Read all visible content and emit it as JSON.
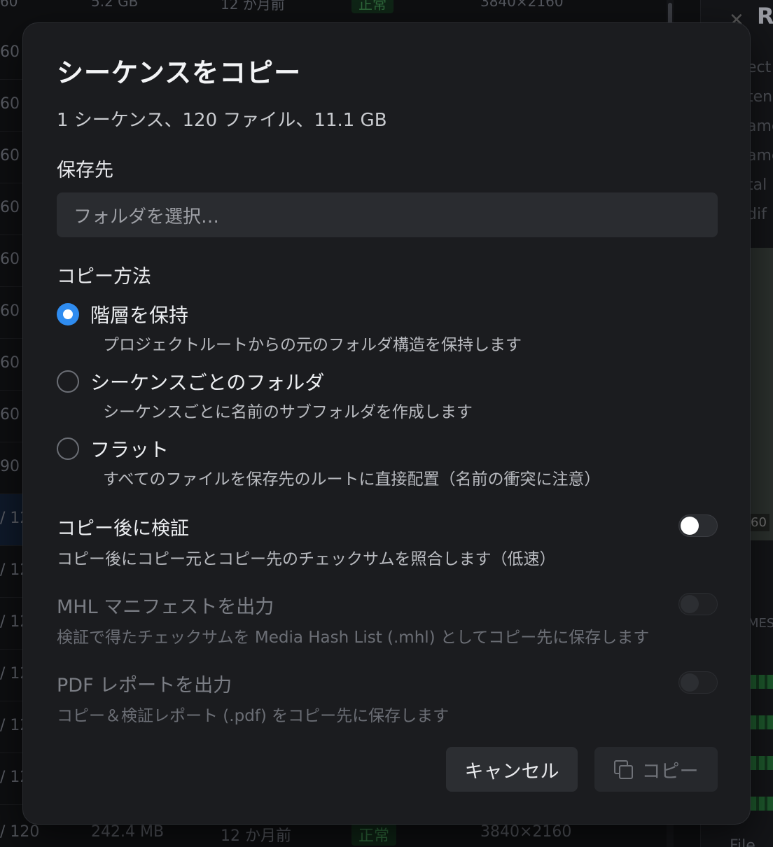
{
  "background": {
    "top_row": {
      "size": "5.2 GB",
      "age": "12 か月前",
      "status": "正常",
      "resolution": "3840×2160",
      "frames": "60"
    },
    "rows": [
      "60",
      "60",
      "60",
      "60",
      "60",
      "60",
      "60",
      "60",
      "90",
      "/ 12",
      "/ 12",
      "/ 12",
      "/ 12",
      "/ 12",
      "/ 12"
    ],
    "bottom_row": {
      "frames": "/ 120",
      "size": "242.4 MB",
      "age": "12 か月前",
      "status": "正常",
      "resolution": "3840×2160"
    },
    "panel": {
      "title": "R",
      "items": [
        "ect",
        "ten",
        "ame",
        "ame",
        "tal",
        "dif"
      ],
      "preview_tag": "60",
      "section": "MES",
      "file_label": "File"
    }
  },
  "dialog": {
    "title": "シーケンスをコピー",
    "summary": "1 シーケンス、120 ファイル、11.1 GB",
    "destination": {
      "label": "保存先",
      "placeholder": "フォルダを選択…"
    },
    "method": {
      "label": "コピー方法",
      "options": [
        {
          "label": "階層を保持",
          "description": "プロジェクトルートからの元のフォルダ構造を保持します",
          "checked": true
        },
        {
          "label": "シーケンスごとのフォルダ",
          "description": "シーケンスごとに名前のサブフォルダを作成します",
          "checked": false
        },
        {
          "label": "フラット",
          "description": "すべてのファイルを保存先のルートに直接配置（名前の衝突に注意）",
          "checked": false
        }
      ]
    },
    "verify": {
      "title": "コピー後に検証",
      "description": "コピー後にコピー元とコピー先のチェックサムを照合します（低速）",
      "enabled": false
    },
    "mhl": {
      "title": "MHL マニフェストを出力",
      "description": "検証で得たチェックサムを Media Hash List (.mhl) としてコピー先に保存します",
      "enabled": false,
      "disabled": true
    },
    "pdf": {
      "title": "PDF レポートを出力",
      "description": "コピー＆検証レポート (.pdf) をコピー先に保存します",
      "enabled": false,
      "disabled": true
    },
    "buttons": {
      "cancel": "キャンセル",
      "copy": "コピー"
    }
  },
  "colors": {
    "accent": "#2f8cf0",
    "dialog_bg": "#1b1c1f",
    "input_bg": "#2a2c30"
  }
}
